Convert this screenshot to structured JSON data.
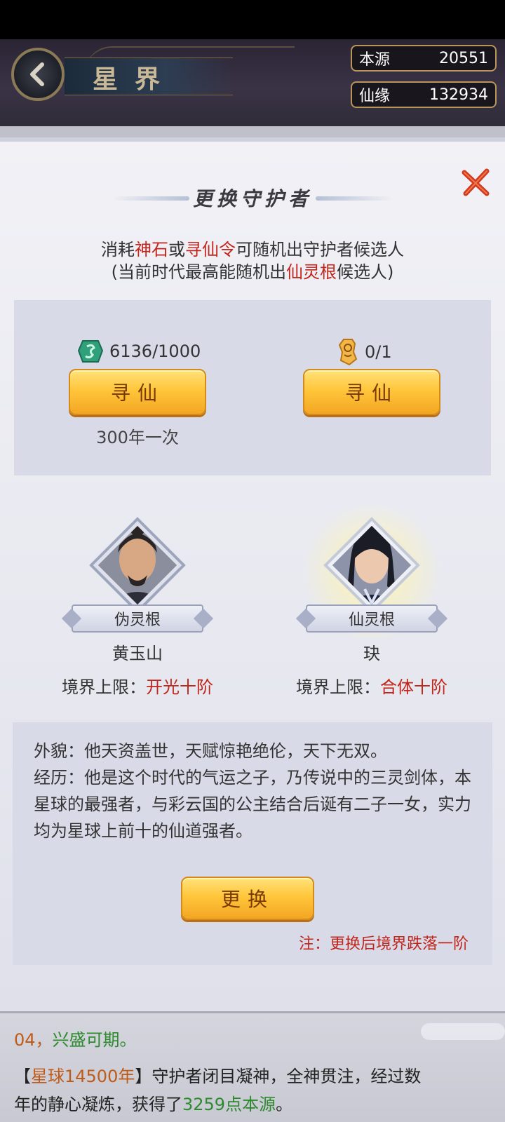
{
  "header": {
    "title": "星界",
    "resources": [
      {
        "label": "本源",
        "value": "20551"
      },
      {
        "label": "仙缘",
        "value": "132934"
      }
    ]
  },
  "dialog": {
    "title": "更换守护者",
    "desc_line1": {
      "pre": "消耗",
      "item1": "神石",
      "mid": "或",
      "item2": "寻仙令",
      "post": "可随机出守护者候选人"
    },
    "desc_line2": {
      "pre": "(当前时代最高能随机出",
      "highlight": "仙灵根",
      "post": "候选人)"
    },
    "recruit": {
      "left": {
        "cost": "6136/1000",
        "button": "寻仙",
        "frequency": "300年一次",
        "icon": "spirit-stone-icon"
      },
      "right": {
        "cost": "0/1",
        "button": "寻仙",
        "icon": "xunxian-token-icon"
      }
    },
    "candidates": [
      {
        "root": "伪灵根",
        "name": "黄玉山",
        "limit_label": "境界上限：",
        "limit_value": "开光十阶"
      },
      {
        "root": "仙灵根",
        "name": "玦",
        "limit_label": "境界上限：",
        "limit_value": "合体十阶"
      }
    ],
    "bio": {
      "appearance": "外貌：他天资盖世，天赋惊艳绝伦，天下无双。",
      "history": "经历：他是这个时代的气运之子，乃传说中的三灵剑体，本星球的最强者，与彩云国的公主结合后诞有二子一女，实力均为星球上前十的仙道强者。"
    },
    "swap_button": "更换",
    "note": "注：更换后境界跌落一阶"
  },
  "log": {
    "line1_pre": "04，",
    "line1_green": "兴盛可期。",
    "line2_bracket_open": "【",
    "line2_time": "星球14500年",
    "line2_bracket_close": "】",
    "line2_text": "守护者闭目凝神，全神贯注，经过数",
    "line3_text": "年的静心凝炼，获得了",
    "line3_value": "3259点本源",
    "line3_end": "。"
  },
  "colors": {
    "accent_red": "#c0261c",
    "gold_button": "#ffc63b",
    "panel_bg": "#e8e9f0"
  }
}
